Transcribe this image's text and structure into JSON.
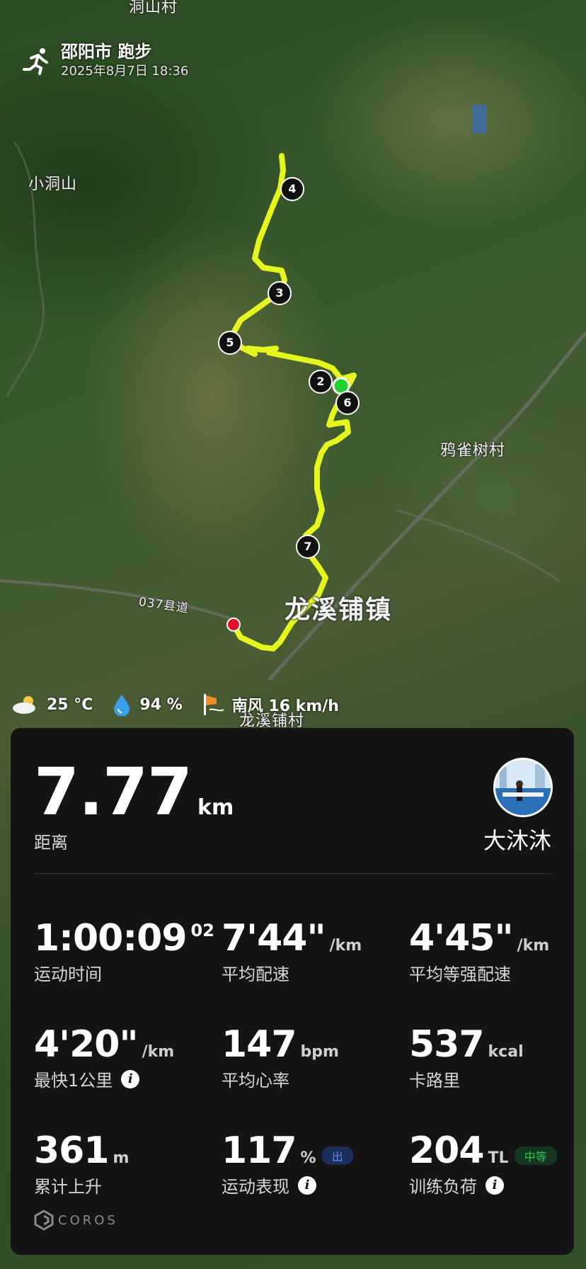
{
  "header": {
    "title": "邵阳市 跑步",
    "datetime": "2025年8月7日 18:36"
  },
  "map": {
    "labels": {
      "north": "洞山村",
      "xiaodongshan": "小洞山",
      "yaqueshu": "鸦雀树村",
      "road": "037县道",
      "town": "龙溪铺镇",
      "bottom": "龙溪铺村"
    },
    "markers": [
      "4",
      "3",
      "5",
      "2",
      "6",
      "7"
    ],
    "route_color": "#e5f51d",
    "start_color": "#22d22a",
    "end_color": "#e4102a"
  },
  "weather": {
    "temperature": "25 °C",
    "humidity": "94 %",
    "wind": "南风 16 km/h"
  },
  "summary": {
    "distance_value": "7.77",
    "distance_unit": "km",
    "distance_label": "距离",
    "username": "大沐沐"
  },
  "stats": {
    "time": {
      "value": "1:00:09",
      "fraction": "02",
      "label": "运动时间"
    },
    "avg_pace": {
      "value": "7'44\"",
      "unit": "/km",
      "label": "平均配速"
    },
    "grade_pace": {
      "value": "4'45\"",
      "unit": "/km",
      "label": "平均等强配速"
    },
    "fastest_km": {
      "value": "4'20\"",
      "unit": "/km",
      "label": "最快1公里"
    },
    "avg_hr": {
      "value": "147",
      "unit": "bpm",
      "label": "平均心率"
    },
    "calories": {
      "value": "537",
      "unit": "kcal",
      "label": "卡路里"
    },
    "ascent": {
      "value": "361",
      "unit": "m",
      "label": "累计上升"
    },
    "performance": {
      "value": "117",
      "unit": "%",
      "badge": "出",
      "label": "运动表现"
    },
    "training_load": {
      "value": "204",
      "unit": "TL",
      "badge": "中等",
      "label": "训练负荷"
    }
  },
  "brand": "COROS"
}
